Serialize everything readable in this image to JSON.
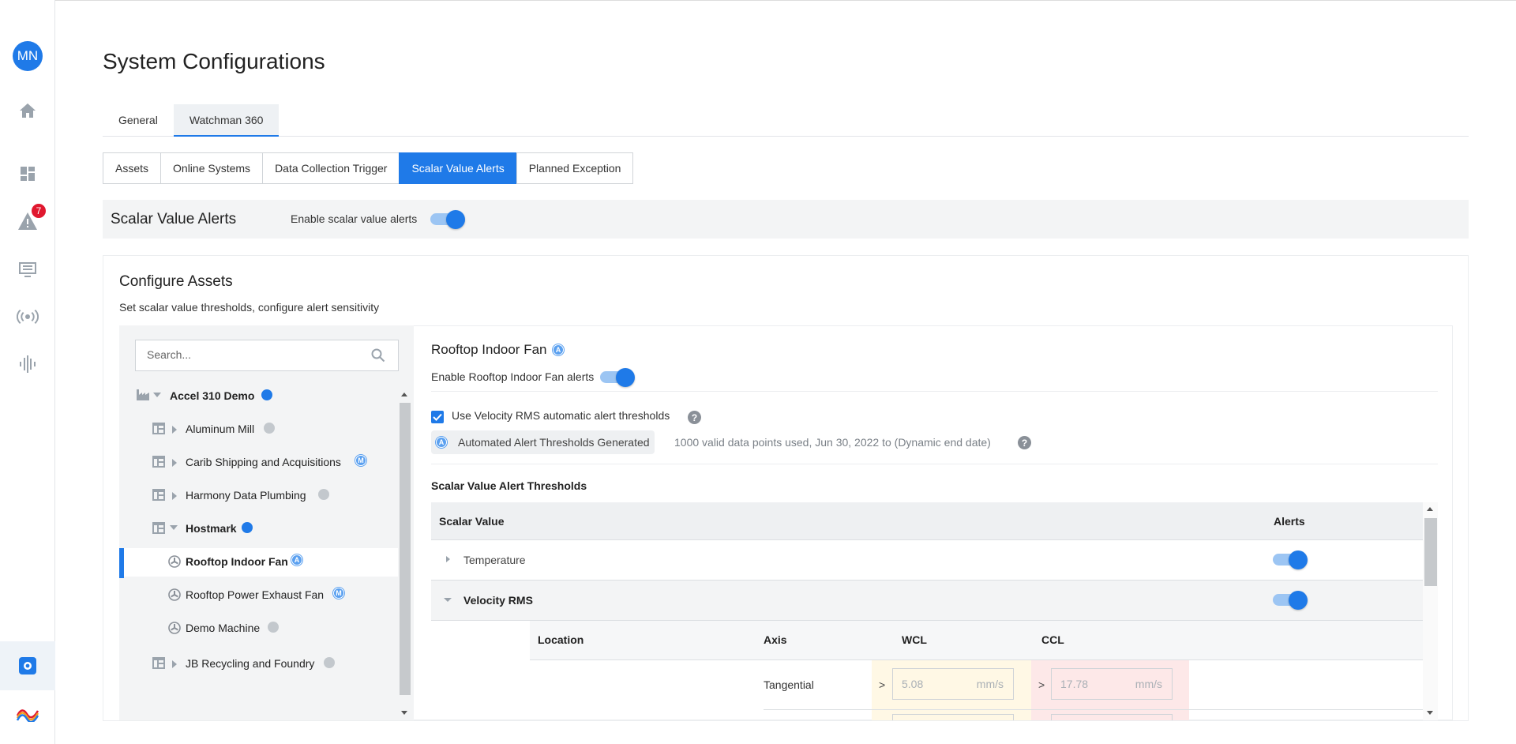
{
  "user": {
    "initials": "MN"
  },
  "nav": {
    "alert_count": "7"
  },
  "page": {
    "title": "System Configurations"
  },
  "tabs": [
    {
      "label": "General",
      "active": false
    },
    {
      "label": "Watchman 360",
      "active": true
    }
  ],
  "subtabs": [
    {
      "label": "Assets"
    },
    {
      "label": "Online Systems"
    },
    {
      "label": "Data Collection Trigger"
    },
    {
      "label": "Scalar Value Alerts"
    },
    {
      "label": "Planned Exception"
    }
  ],
  "alerts_bar": {
    "title": "Scalar Value Alerts",
    "enable_label": "Enable scalar value alerts",
    "enabled": true
  },
  "configure": {
    "title": "Configure Assets",
    "subtitle": "Set scalar value thresholds, configure alert sensitivity",
    "search_placeholder": "Search...",
    "tree": [
      {
        "label": "Accel 310 Demo",
        "dot": "blue"
      },
      {
        "label": "Aluminum Mill",
        "dot": "gray"
      },
      {
        "label": "Carib Shipping and Acquisitions",
        "dot": "M"
      },
      {
        "label": "Harmony Data Plumbing",
        "dot": "gray"
      },
      {
        "label": "Hostmark",
        "dot": "blue"
      },
      {
        "label": "Rooftop Indoor Fan",
        "dot": "A"
      },
      {
        "label": "Rooftop Power Exhaust Fan",
        "dot": "M"
      },
      {
        "label": "Demo Machine",
        "dot": "gray"
      },
      {
        "label": "JB Recycling and Foundry",
        "dot": "gray"
      }
    ],
    "dot_letters": {
      "a": "A",
      "m": "M"
    }
  },
  "detail": {
    "asset_name": "Rooftop Indoor Fan",
    "enable_label": "Enable Rooftop Indoor Fan alerts",
    "enabled": true,
    "auto_threshold_label": "Use Velocity RMS automatic alert thresholds",
    "auto_threshold_checked": true,
    "generated_label": "Automated Alert Thresholds Generated",
    "generated_desc": "1000 valid data points used, Jun 30, 2022 to (Dynamic end date)",
    "help_glyph": "?",
    "thresholds_title": "Scalar Value Alert Thresholds",
    "table": {
      "col_scalar": "Scalar Value",
      "col_alerts": "Alerts",
      "rows": [
        {
          "name": "Temperature",
          "alerts_on": true,
          "expanded": false
        },
        {
          "name": "Velocity RMS",
          "alerts_on": true,
          "expanded": true
        }
      ],
      "sub": {
        "col_location": "Location",
        "col_axis": "Axis",
        "col_wcl": "WCL",
        "col_ccl": "CCL",
        "axis": "Tangential",
        "operator": ">",
        "wcl_value": "5.08",
        "ccl_value": "17.78",
        "unit": "mm/s"
      }
    }
  },
  "colors": {
    "accent": "#1f7ae8",
    "alert_badge": "#e0182f",
    "wcl_bg": "#fff8e5",
    "ccl_bg": "#fde8e8"
  }
}
